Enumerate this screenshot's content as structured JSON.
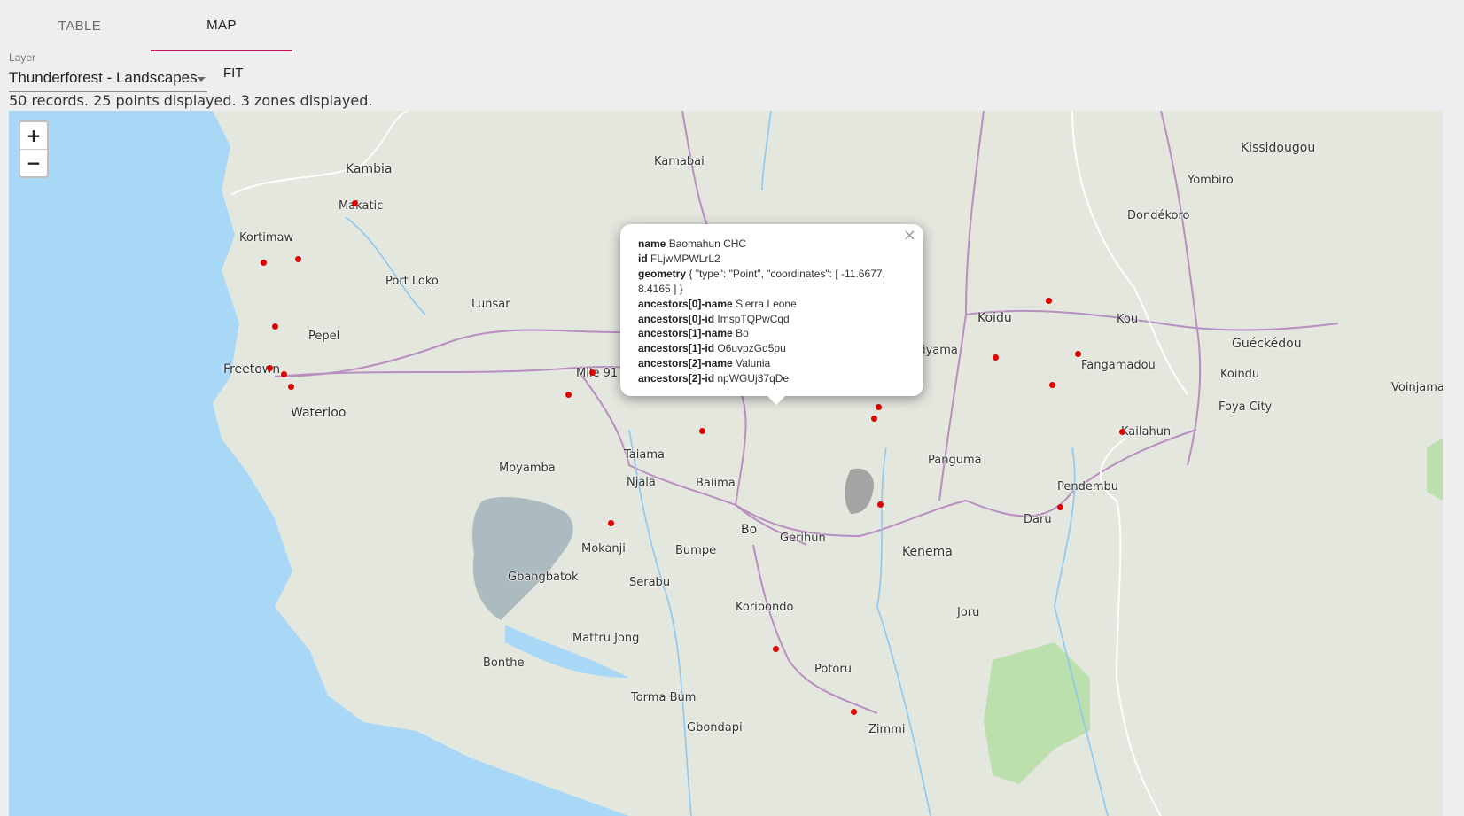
{
  "tabs": [
    {
      "label": "TABLE",
      "active": false
    },
    {
      "label": "MAP",
      "active": true
    }
  ],
  "layer": {
    "label": "Layer",
    "value": "Thunderforest - Landscapes"
  },
  "fit_label": "FIT",
  "summary": "50 records. 25 points displayed. 3 zones displayed.",
  "zoom": {
    "in": "+",
    "out": "−"
  },
  "popup": {
    "close": "×",
    "rows": [
      {
        "key": "name",
        "value": "Baomahun CHC"
      },
      {
        "key": "id",
        "value": "FLjwMPWLrL2"
      },
      {
        "key": "geometry",
        "value": "{ \"type\": \"Point\", \"coordinates\": [ -11.6677, 8.4165 ] }"
      },
      {
        "key": "ancestors[0]-name",
        "value": "Sierra Leone"
      },
      {
        "key": "ancestors[0]-id",
        "value": "ImspTQPwCqd"
      },
      {
        "key": "ancestors[1]-name",
        "value": "Bo"
      },
      {
        "key": "ancestors[1]-id",
        "value": "O6uvpzGd5pu"
      },
      {
        "key": "ancestors[2]-name",
        "value": "Valunia"
      },
      {
        "key": "ancestors[2]-id",
        "value": "npWGUj37qDe"
      }
    ]
  },
  "places": [
    "Kambia",
    "Kamabai",
    "Kissidougou",
    "Yombiro",
    "Makatic",
    "Dondékoro",
    "Kortimaw",
    "Port Loko",
    "Lunsar",
    "Koidu",
    "Pepel",
    "Kou",
    "Guéckédou",
    "Freetown",
    "Mile 91",
    "iyama",
    "Fangamadou",
    "Koindu",
    "Waterloo",
    "Voinjama",
    "Foya City",
    "Kailahun",
    "Taiama",
    "Moyamba",
    "Panguma",
    "Njala",
    "Baiima",
    "Pendembu",
    "Bo",
    "Gerihun",
    "Daru",
    "Mokanji",
    "Bumpe",
    "Kenema",
    "Gbangbatok",
    "Serabu",
    "Koribondo",
    "Joru",
    "Mattru Jong",
    "Bonthe",
    "Potoru",
    "Torma Bum",
    "Gbondapi",
    "Zimmi"
  ],
  "colors": {
    "water": "#a9d8f7",
    "land": "#e3e7de",
    "point": "#e00000",
    "accent": "#c2185b",
    "road": "#b98ec0"
  }
}
